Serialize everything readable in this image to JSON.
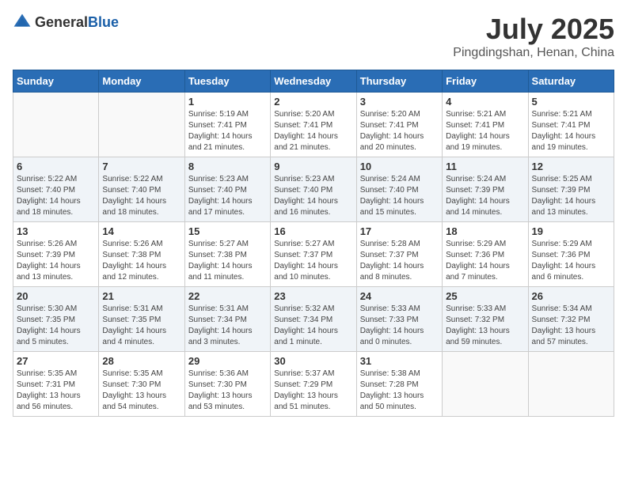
{
  "header": {
    "logo_general": "General",
    "logo_blue": "Blue",
    "month_title": "July 2025",
    "location": "Pingdingshan, Henan, China"
  },
  "weekdays": [
    "Sunday",
    "Monday",
    "Tuesday",
    "Wednesday",
    "Thursday",
    "Friday",
    "Saturday"
  ],
  "weeks": [
    [
      {
        "day": "",
        "sunrise": "",
        "sunset": "",
        "daylight": ""
      },
      {
        "day": "",
        "sunrise": "",
        "sunset": "",
        "daylight": ""
      },
      {
        "day": "1",
        "sunrise": "Sunrise: 5:19 AM",
        "sunset": "Sunset: 7:41 PM",
        "daylight": "Daylight: 14 hours and 21 minutes."
      },
      {
        "day": "2",
        "sunrise": "Sunrise: 5:20 AM",
        "sunset": "Sunset: 7:41 PM",
        "daylight": "Daylight: 14 hours and 21 minutes."
      },
      {
        "day": "3",
        "sunrise": "Sunrise: 5:20 AM",
        "sunset": "Sunset: 7:41 PM",
        "daylight": "Daylight: 14 hours and 20 minutes."
      },
      {
        "day": "4",
        "sunrise": "Sunrise: 5:21 AM",
        "sunset": "Sunset: 7:41 PM",
        "daylight": "Daylight: 14 hours and 19 minutes."
      },
      {
        "day": "5",
        "sunrise": "Sunrise: 5:21 AM",
        "sunset": "Sunset: 7:41 PM",
        "daylight": "Daylight: 14 hours and 19 minutes."
      }
    ],
    [
      {
        "day": "6",
        "sunrise": "Sunrise: 5:22 AM",
        "sunset": "Sunset: 7:40 PM",
        "daylight": "Daylight: 14 hours and 18 minutes."
      },
      {
        "day": "7",
        "sunrise": "Sunrise: 5:22 AM",
        "sunset": "Sunset: 7:40 PM",
        "daylight": "Daylight: 14 hours and 18 minutes."
      },
      {
        "day": "8",
        "sunrise": "Sunrise: 5:23 AM",
        "sunset": "Sunset: 7:40 PM",
        "daylight": "Daylight: 14 hours and 17 minutes."
      },
      {
        "day": "9",
        "sunrise": "Sunrise: 5:23 AM",
        "sunset": "Sunset: 7:40 PM",
        "daylight": "Daylight: 14 hours and 16 minutes."
      },
      {
        "day": "10",
        "sunrise": "Sunrise: 5:24 AM",
        "sunset": "Sunset: 7:40 PM",
        "daylight": "Daylight: 14 hours and 15 minutes."
      },
      {
        "day": "11",
        "sunrise": "Sunrise: 5:24 AM",
        "sunset": "Sunset: 7:39 PM",
        "daylight": "Daylight: 14 hours and 14 minutes."
      },
      {
        "day": "12",
        "sunrise": "Sunrise: 5:25 AM",
        "sunset": "Sunset: 7:39 PM",
        "daylight": "Daylight: 14 hours and 13 minutes."
      }
    ],
    [
      {
        "day": "13",
        "sunrise": "Sunrise: 5:26 AM",
        "sunset": "Sunset: 7:39 PM",
        "daylight": "Daylight: 14 hours and 13 minutes."
      },
      {
        "day": "14",
        "sunrise": "Sunrise: 5:26 AM",
        "sunset": "Sunset: 7:38 PM",
        "daylight": "Daylight: 14 hours and 12 minutes."
      },
      {
        "day": "15",
        "sunrise": "Sunrise: 5:27 AM",
        "sunset": "Sunset: 7:38 PM",
        "daylight": "Daylight: 14 hours and 11 minutes."
      },
      {
        "day": "16",
        "sunrise": "Sunrise: 5:27 AM",
        "sunset": "Sunset: 7:37 PM",
        "daylight": "Daylight: 14 hours and 10 minutes."
      },
      {
        "day": "17",
        "sunrise": "Sunrise: 5:28 AM",
        "sunset": "Sunset: 7:37 PM",
        "daylight": "Daylight: 14 hours and 8 minutes."
      },
      {
        "day": "18",
        "sunrise": "Sunrise: 5:29 AM",
        "sunset": "Sunset: 7:36 PM",
        "daylight": "Daylight: 14 hours and 7 minutes."
      },
      {
        "day": "19",
        "sunrise": "Sunrise: 5:29 AM",
        "sunset": "Sunset: 7:36 PM",
        "daylight": "Daylight: 14 hours and 6 minutes."
      }
    ],
    [
      {
        "day": "20",
        "sunrise": "Sunrise: 5:30 AM",
        "sunset": "Sunset: 7:35 PM",
        "daylight": "Daylight: 14 hours and 5 minutes."
      },
      {
        "day": "21",
        "sunrise": "Sunrise: 5:31 AM",
        "sunset": "Sunset: 7:35 PM",
        "daylight": "Daylight: 14 hours and 4 minutes."
      },
      {
        "day": "22",
        "sunrise": "Sunrise: 5:31 AM",
        "sunset": "Sunset: 7:34 PM",
        "daylight": "Daylight: 14 hours and 3 minutes."
      },
      {
        "day": "23",
        "sunrise": "Sunrise: 5:32 AM",
        "sunset": "Sunset: 7:34 PM",
        "daylight": "Daylight: 14 hours and 1 minute."
      },
      {
        "day": "24",
        "sunrise": "Sunrise: 5:33 AM",
        "sunset": "Sunset: 7:33 PM",
        "daylight": "Daylight: 14 hours and 0 minutes."
      },
      {
        "day": "25",
        "sunrise": "Sunrise: 5:33 AM",
        "sunset": "Sunset: 7:32 PM",
        "daylight": "Daylight: 13 hours and 59 minutes."
      },
      {
        "day": "26",
        "sunrise": "Sunrise: 5:34 AM",
        "sunset": "Sunset: 7:32 PM",
        "daylight": "Daylight: 13 hours and 57 minutes."
      }
    ],
    [
      {
        "day": "27",
        "sunrise": "Sunrise: 5:35 AM",
        "sunset": "Sunset: 7:31 PM",
        "daylight": "Daylight: 13 hours and 56 minutes."
      },
      {
        "day": "28",
        "sunrise": "Sunrise: 5:35 AM",
        "sunset": "Sunset: 7:30 PM",
        "daylight": "Daylight: 13 hours and 54 minutes."
      },
      {
        "day": "29",
        "sunrise": "Sunrise: 5:36 AM",
        "sunset": "Sunset: 7:30 PM",
        "daylight": "Daylight: 13 hours and 53 minutes."
      },
      {
        "day": "30",
        "sunrise": "Sunrise: 5:37 AM",
        "sunset": "Sunset: 7:29 PM",
        "daylight": "Daylight: 13 hours and 51 minutes."
      },
      {
        "day": "31",
        "sunrise": "Sunrise: 5:38 AM",
        "sunset": "Sunset: 7:28 PM",
        "daylight": "Daylight: 13 hours and 50 minutes."
      },
      {
        "day": "",
        "sunrise": "",
        "sunset": "",
        "daylight": ""
      },
      {
        "day": "",
        "sunrise": "",
        "sunset": "",
        "daylight": ""
      }
    ]
  ]
}
